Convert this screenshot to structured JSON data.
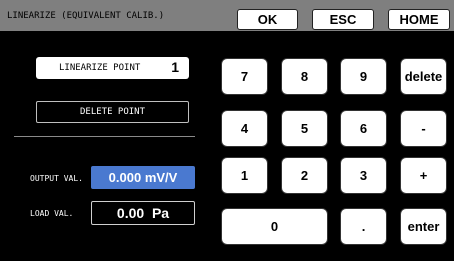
{
  "header": {
    "title": "LINEARIZE (EQUIVALENT CALIB.)",
    "ok_label": "OK",
    "esc_label": "ESC",
    "home_label": "HOME"
  },
  "left": {
    "linearize_point_label": "LINEARIZE POINT",
    "linearize_point_value": "1",
    "delete_point_label": "DELETE POINT",
    "output_label": "OUTPUT VAL.",
    "output_value": "0.000 mV/V",
    "load_label": "LOAD VAL.",
    "load_value": "0.00  Pa"
  },
  "keypad": {
    "k7": "7",
    "k8": "8",
    "k9": "9",
    "delete": "delete",
    "k4": "4",
    "k5": "5",
    "k6": "6",
    "minus": "-",
    "k1": "1",
    "k2": "2",
    "k3": "3",
    "plus": "+",
    "k0": "0",
    "dot": ".",
    "enter": "enter"
  },
  "colors": {
    "titlebar": "#7f7f7f",
    "output_highlight": "#4a79d0",
    "background": "#000000"
  }
}
